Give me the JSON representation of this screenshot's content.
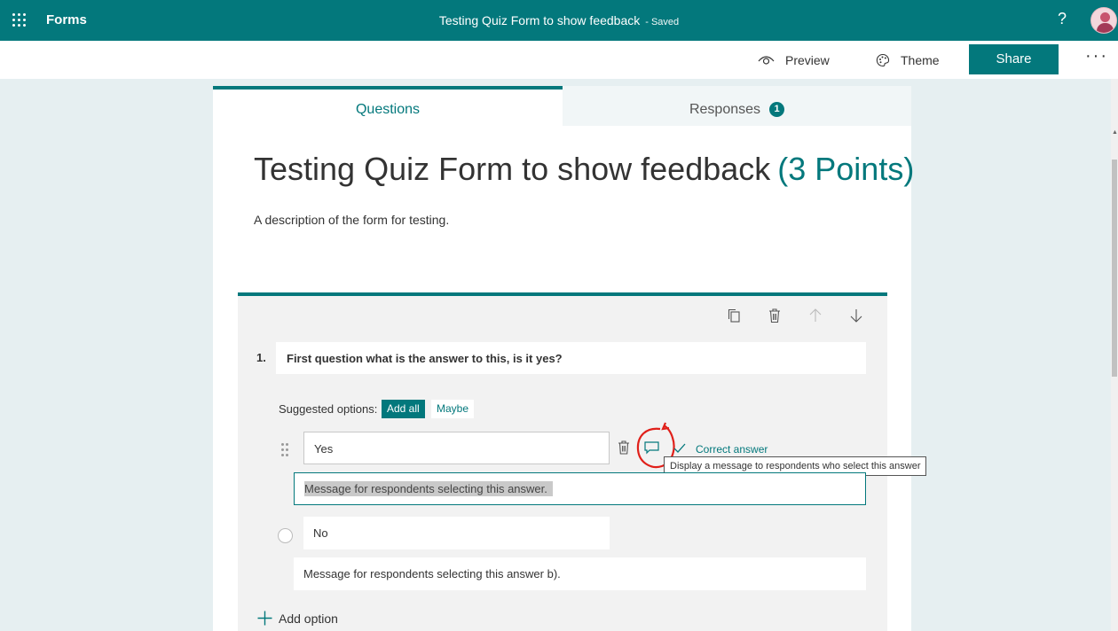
{
  "header": {
    "app_name": "Forms",
    "doc_title": "Testing Quiz Form to show feedback",
    "save_status": "- Saved",
    "help": "?"
  },
  "commands": {
    "preview": "Preview",
    "theme": "Theme",
    "share": "Share",
    "more": "···"
  },
  "tabs": {
    "questions": "Questions",
    "responses": "Responses",
    "responses_count": "1"
  },
  "form": {
    "title": "Testing Quiz Form to show feedback",
    "points": "(3 Points)",
    "description": "A description of the form for testing."
  },
  "question": {
    "number": "1.",
    "title": "First question what is the answer to this, is it yes?",
    "suggested_label": "Suggested options:",
    "add_all": "Add all",
    "maybe": "Maybe",
    "options": [
      {
        "label": "Yes",
        "message": "Message for respondents selecting this answer.",
        "correct_label": "Correct answer"
      },
      {
        "label": "No",
        "message": "Message for respondents selecting this answer b)."
      }
    ],
    "tooltip": "Display a message to respondents who select this answer",
    "add_option": "Add option"
  },
  "colors": {
    "brand": "#03787c",
    "annotation": "#e0201a"
  }
}
